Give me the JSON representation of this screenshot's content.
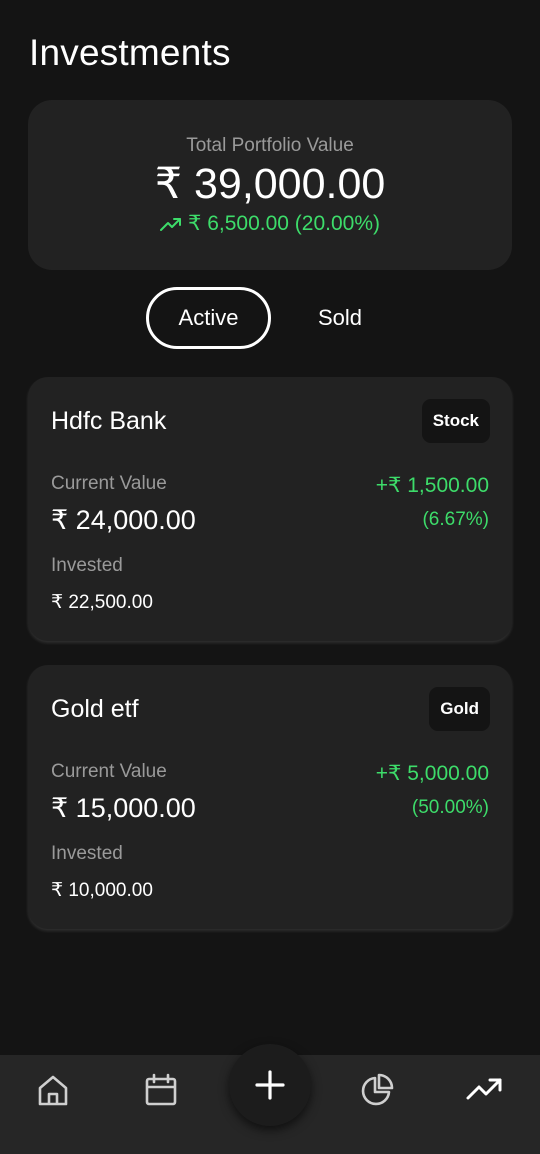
{
  "page": {
    "title": "Investments"
  },
  "summary": {
    "label": "Total Portfolio Value",
    "value": "₹ 39,000.00",
    "change": "₹ 6,500.00 (20.00%)",
    "trend_icon": "trending-up-icon"
  },
  "tabs": [
    {
      "label": "Active",
      "selected": true
    },
    {
      "label": "Sold",
      "selected": false
    }
  ],
  "investments": [
    {
      "name": "Hdfc Bank",
      "type": "Stock",
      "current_value_label": "Current Value",
      "current_value": "₹ 24,000.00",
      "gain": "+₹ 1,500.00",
      "gain_percent": "(6.67%)",
      "invested_label": "Invested",
      "invested": "₹ 22,500.00"
    },
    {
      "name": "Gold etf",
      "type": "Gold",
      "current_value_label": "Current Value",
      "current_value": "₹ 15,000.00",
      "gain": "+₹ 5,000.00",
      "gain_percent": "(50.00%)",
      "invested_label": "Invested",
      "invested": "₹ 10,000.00"
    }
  ],
  "nav": [
    {
      "icon": "home-icon",
      "selected": false
    },
    {
      "icon": "calendar-icon",
      "selected": false
    },
    {
      "icon": "plus-icon",
      "selected": false
    },
    {
      "icon": "pie-chart-icon",
      "selected": false
    },
    {
      "icon": "trending-up-icon",
      "selected": true
    }
  ],
  "colors": {
    "background": "#141414",
    "card": "#222222",
    "positive": "#3ddc6a",
    "muted_text": "#9a9a9a"
  }
}
